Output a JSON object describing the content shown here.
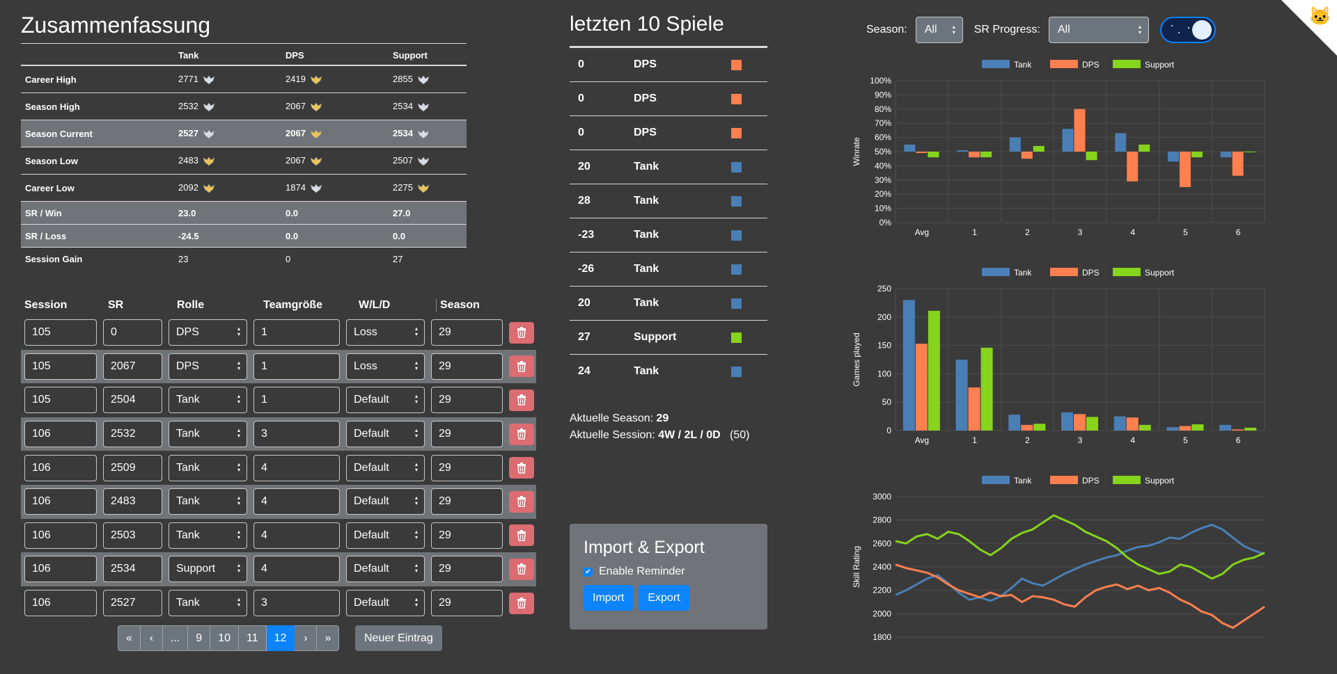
{
  "summary": {
    "title": "Zusammenfassung",
    "headers": [
      "",
      "Tank",
      "DPS",
      "Support"
    ],
    "rows": [
      {
        "label": "Career High",
        "values": [
          "2771",
          "2419",
          "2855"
        ],
        "icons": [
          "silver",
          "gold",
          "silver"
        ],
        "highlight": false
      },
      {
        "label": "Season High",
        "values": [
          "2532",
          "2067",
          "2534"
        ],
        "icons": [
          "silver",
          "gold",
          "silver"
        ],
        "highlight": false
      },
      {
        "label": "Season Current",
        "values": [
          "2527",
          "2067",
          "2534"
        ],
        "icons": [
          "silver",
          "gold",
          "silver"
        ],
        "highlight": true
      },
      {
        "label": "Season Low",
        "values": [
          "2483",
          "2067",
          "2507"
        ],
        "icons": [
          "gold",
          "gold",
          "silver"
        ],
        "highlight": false
      },
      {
        "label": "Career Low",
        "values": [
          "2092",
          "1874",
          "2275"
        ],
        "icons": [
          "gold",
          "silver",
          "gold"
        ],
        "highlight": false
      },
      {
        "label": "SR / Win",
        "values": [
          "23.0",
          "0.0",
          "27.0"
        ],
        "icons": [
          "",
          "",
          ""
        ],
        "highlight": true
      },
      {
        "label": "SR / Loss",
        "values": [
          "-24.5",
          "0.0",
          "0.0"
        ],
        "icons": [
          "",
          "",
          ""
        ],
        "highlight": true
      },
      {
        "label": "Session Gain",
        "values": [
          "23",
          "0",
          "27"
        ],
        "icons": [
          "",
          "",
          ""
        ],
        "highlight": false
      }
    ]
  },
  "entries": {
    "headers": {
      "session": "Session",
      "sr": "SR",
      "role": "Rolle",
      "team": "Teamgröße",
      "wld": "W/L/D",
      "season": "Season"
    },
    "rows": [
      {
        "session": "105",
        "sr": "0",
        "role": "DPS",
        "team": "1",
        "wld": "Loss",
        "season": "29"
      },
      {
        "session": "105",
        "sr": "2067",
        "role": "DPS",
        "team": "1",
        "wld": "Loss",
        "season": "29"
      },
      {
        "session": "105",
        "sr": "2504",
        "role": "Tank",
        "team": "1",
        "wld": "Default",
        "season": "29"
      },
      {
        "session": "106",
        "sr": "2532",
        "role": "Tank",
        "team": "3",
        "wld": "Default",
        "season": "29"
      },
      {
        "session": "106",
        "sr": "2509",
        "role": "Tank",
        "team": "4",
        "wld": "Default",
        "season": "29"
      },
      {
        "session": "106",
        "sr": "2483",
        "role": "Tank",
        "team": "4",
        "wld": "Default",
        "season": "29"
      },
      {
        "session": "106",
        "sr": "2503",
        "role": "Tank",
        "team": "4",
        "wld": "Default",
        "season": "29"
      },
      {
        "session": "106",
        "sr": "2534",
        "role": "Support",
        "team": "4",
        "wld": "Default",
        "season": "29"
      },
      {
        "session": "106",
        "sr": "2527",
        "role": "Tank",
        "team": "3",
        "wld": "Default",
        "season": "29"
      }
    ]
  },
  "pagination": {
    "items": [
      "«",
      "‹",
      "...",
      "9",
      "10",
      "11",
      "12",
      "›",
      "»"
    ],
    "active": "12"
  },
  "new_entry_label": "Neuer Eintrag",
  "last10": {
    "title": "letzten 10 Spiele",
    "games": [
      {
        "sr": "0",
        "role": "DPS"
      },
      {
        "sr": "0",
        "role": "DPS"
      },
      {
        "sr": "0",
        "role": "DPS"
      },
      {
        "sr": "20",
        "role": "Tank"
      },
      {
        "sr": "28",
        "role": "Tank"
      },
      {
        "sr": "-23",
        "role": "Tank"
      },
      {
        "sr": "-26",
        "role": "Tank"
      },
      {
        "sr": "20",
        "role": "Tank"
      },
      {
        "sr": "27",
        "role": "Support"
      },
      {
        "sr": "24",
        "role": "Tank"
      }
    ]
  },
  "info": {
    "season_label": "Aktuelle Season:",
    "season_value": "29",
    "session_label": "Aktuelle Session:",
    "session_value": "4W / 2L / 0D",
    "session_count": "(50)"
  },
  "import_export": {
    "title": "Import & Export",
    "reminder_label": "Enable Reminder",
    "import_label": "Import",
    "export_label": "Export"
  },
  "filters": {
    "season_label": "Season:",
    "season_value": "All",
    "sr_label": "SR Progress:",
    "sr_value": "All"
  },
  "colors": {
    "tank": "#4a7fb5",
    "dps": "#fe7f4f",
    "support": "#86d41c"
  },
  "chart_data": [
    {
      "type": "bar",
      "ylabel": "Winrate",
      "categories": [
        "Avg",
        "1",
        "2",
        "3",
        "4",
        "5",
        "6"
      ],
      "ylim": [
        0,
        100
      ],
      "yticks": [
        "0%",
        "10%",
        "20%",
        "30%",
        "40%",
        "50%",
        "60%",
        "70%",
        "80%",
        "90%",
        "100%"
      ],
      "baseline": 50,
      "series": [
        {
          "name": "Tank",
          "values": [
            55,
            51,
            60,
            66,
            63,
            43,
            46
          ]
        },
        {
          "name": "DPS",
          "values": [
            49,
            46,
            45,
            80,
            29,
            25,
            33
          ]
        },
        {
          "name": "Support",
          "values": [
            46,
            46,
            54,
            44,
            55,
            46,
            50
          ]
        }
      ]
    },
    {
      "type": "bar",
      "ylabel": "Games played",
      "categories": [
        "Avg",
        "1",
        "2",
        "3",
        "4",
        "5",
        "6"
      ],
      "ylim": [
        0,
        250
      ],
      "yticks": [
        "0",
        "50",
        "100",
        "150",
        "200",
        "250"
      ],
      "series": [
        {
          "name": "Tank",
          "values": [
            230,
            125,
            28,
            32,
            25,
            6,
            10
          ]
        },
        {
          "name": "DPS",
          "values": [
            153,
            76,
            10,
            29,
            23,
            8,
            2
          ]
        },
        {
          "name": "Support",
          "values": [
            211,
            146,
            12,
            24,
            10,
            11,
            5
          ]
        }
      ]
    },
    {
      "type": "line",
      "ylabel": "Skill Rating",
      "ylim": [
        1800,
        3000
      ],
      "yticks": [
        "1800",
        "2000",
        "2200",
        "2400",
        "2600",
        "2800",
        "3000"
      ],
      "series": [
        {
          "name": "Tank",
          "values": [
            2160,
            2200,
            2250,
            2300,
            2330,
            2260,
            2180,
            2120,
            2140,
            2110,
            2150,
            2220,
            2300,
            2260,
            2240,
            2290,
            2340,
            2380,
            2420,
            2450,
            2480,
            2500,
            2540,
            2570,
            2580,
            2610,
            2650,
            2640,
            2690,
            2730,
            2760,
            2720,
            2650,
            2580,
            2540,
            2510
          ]
        },
        {
          "name": "DPS",
          "values": [
            2420,
            2390,
            2370,
            2350,
            2310,
            2250,
            2200,
            2170,
            2140,
            2180,
            2150,
            2160,
            2100,
            2150,
            2140,
            2120,
            2080,
            2060,
            2140,
            2200,
            2230,
            2250,
            2210,
            2240,
            2200,
            2220,
            2180,
            2120,
            2080,
            2020,
            1990,
            1920,
            1880,
            1940,
            2000,
            2060
          ]
        },
        {
          "name": "Support",
          "values": [
            2620,
            2600,
            2660,
            2680,
            2640,
            2700,
            2680,
            2620,
            2550,
            2500,
            2560,
            2640,
            2690,
            2720,
            2780,
            2840,
            2800,
            2760,
            2700,
            2660,
            2620,
            2560,
            2480,
            2420,
            2380,
            2340,
            2360,
            2420,
            2400,
            2350,
            2300,
            2340,
            2420,
            2460,
            2480,
            2520
          ]
        }
      ]
    }
  ]
}
